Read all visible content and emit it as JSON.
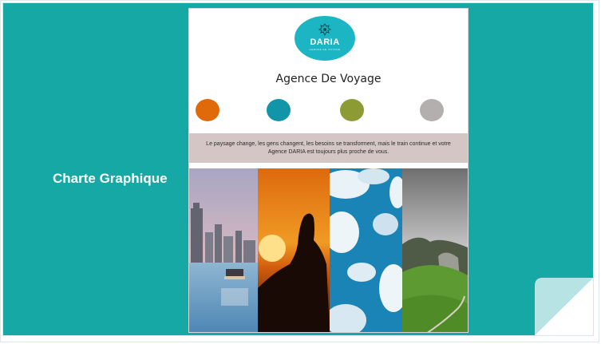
{
  "slide": {
    "side_title": "Charte Graphique"
  },
  "card": {
    "logo_name": "DARIA",
    "logo_sub": "AGENCE DE VOYAGE",
    "title": "Agence De Voyage",
    "tagline": "Le paysage change, les gens changent, les besoins se transforment, mais le train continue et votre Agence DARIA est toujours plus proche de vous."
  },
  "palette": [
    "#e0690a",
    "#1295a9",
    "#8c9b33",
    "#b3afaf"
  ],
  "photos": [
    {
      "icon": "city-skyline-photo"
    },
    {
      "icon": "sunset-silhouette-photo"
    },
    {
      "icon": "sky-clouds-photo"
    },
    {
      "icon": "mountain-meadow-photo"
    }
  ],
  "colors": {
    "background": "#16a8a4",
    "logo": "#1bb5c4",
    "tagline_band": "#d4c6c4"
  }
}
